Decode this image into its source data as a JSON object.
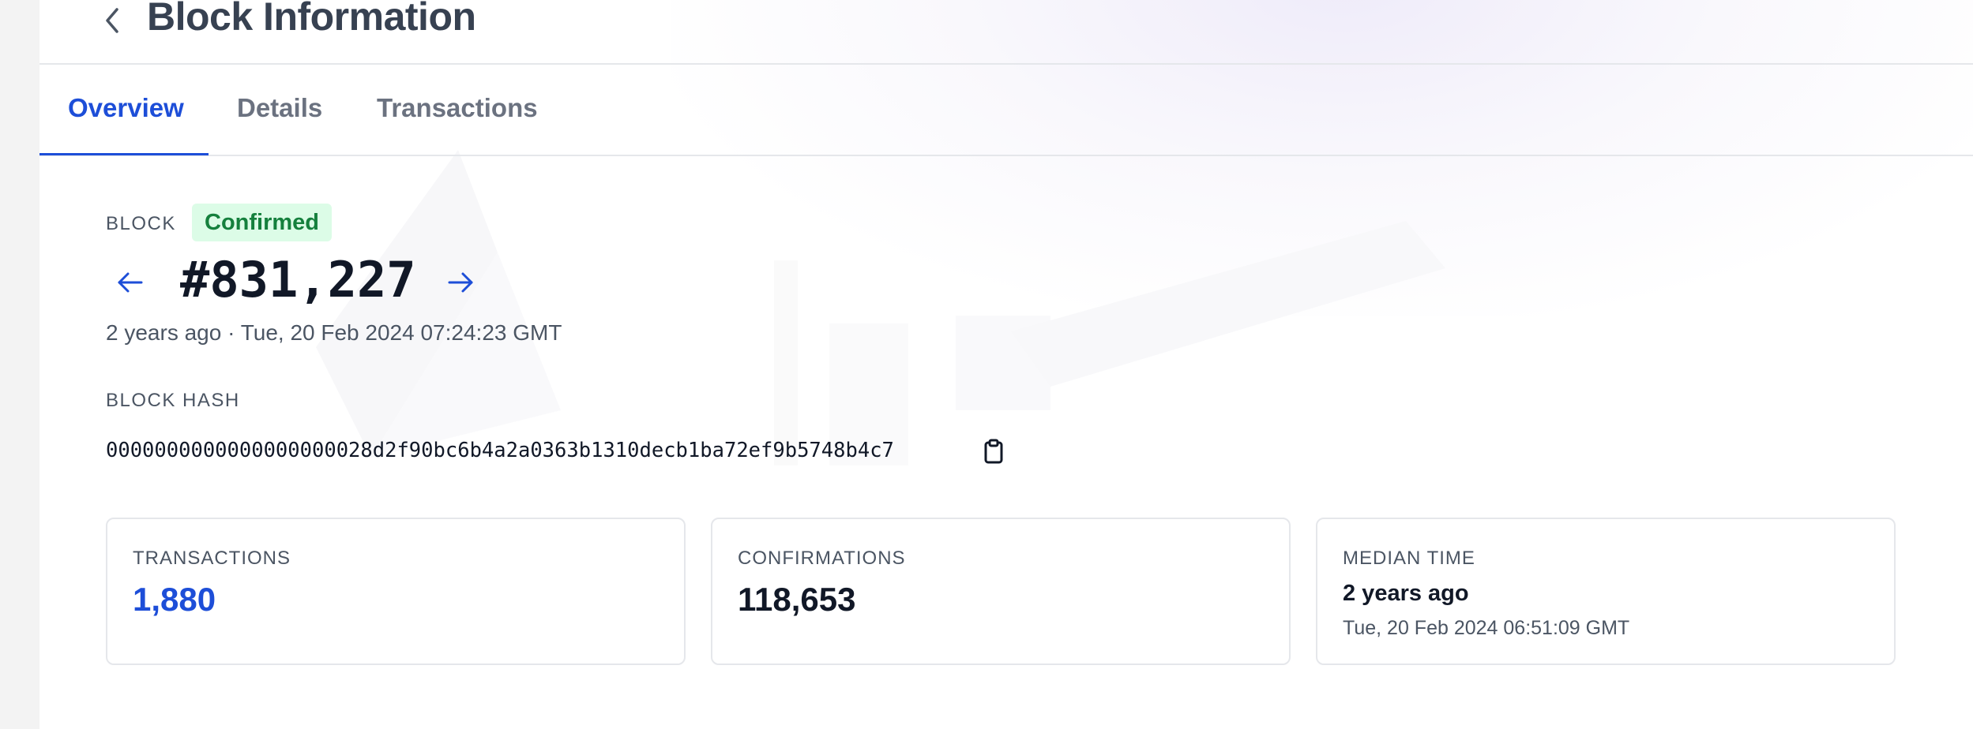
{
  "header": {
    "title": "Block Information",
    "back_icon": "chevron-left-icon"
  },
  "tabs": [
    {
      "label": "Overview",
      "active": true
    },
    {
      "label": "Details",
      "active": false
    },
    {
      "label": "Transactions",
      "active": false
    }
  ],
  "block": {
    "label": "BLOCK",
    "status": "Confirmed",
    "number": "#831,227",
    "time": "2 years ago · Tue, 20 Feb 2024 07:24:23 GMT",
    "prev_icon": "arrow-left-icon",
    "next_icon": "arrow-right-icon"
  },
  "hash": {
    "label": "BLOCK HASH",
    "value": "0000000000000000000028d2f90bc6b4a2a0363b1310decb1ba72ef9b5748b4c7",
    "copy_icon": "clipboard-icon"
  },
  "stats": {
    "transactions": {
      "label": "TRANSACTIONS",
      "value": "1,880"
    },
    "confirmations": {
      "label": "CONFIRMATIONS",
      "value": "118,653"
    },
    "median_time": {
      "label": "MEDIAN TIME",
      "relative": "2 years ago",
      "absolute": "Tue, 20 Feb 2024 06:51:09 GMT"
    }
  },
  "colors": {
    "accent": "#1d4ed8",
    "confirmed_bg": "#dcfce7",
    "confirmed_text": "#15803d",
    "border": "#e5e7eb"
  }
}
